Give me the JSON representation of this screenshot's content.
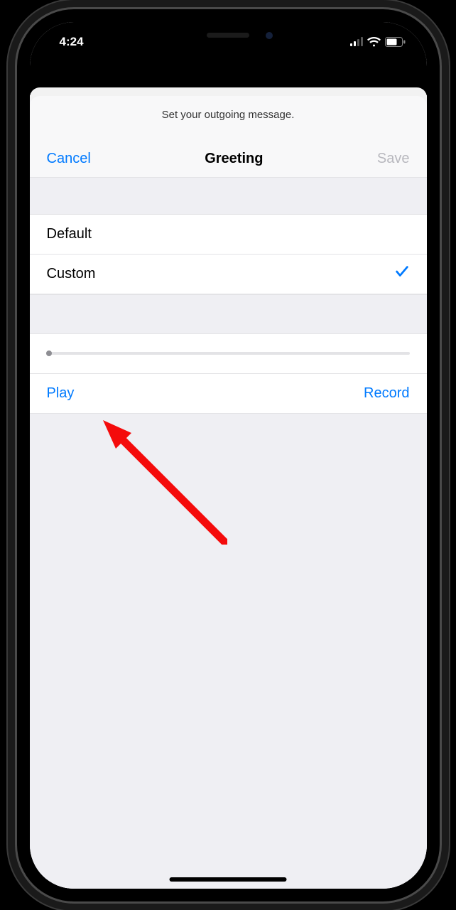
{
  "statusbar": {
    "time": "4:24"
  },
  "header": {
    "subtitle": "Set your outgoing message.",
    "cancel": "Cancel",
    "title": "Greeting",
    "save": "Save"
  },
  "options": {
    "default_label": "Default",
    "custom_label": "Custom",
    "selected": "custom"
  },
  "actions": {
    "play": "Play",
    "record": "Record"
  },
  "playback": {
    "position": 0
  }
}
